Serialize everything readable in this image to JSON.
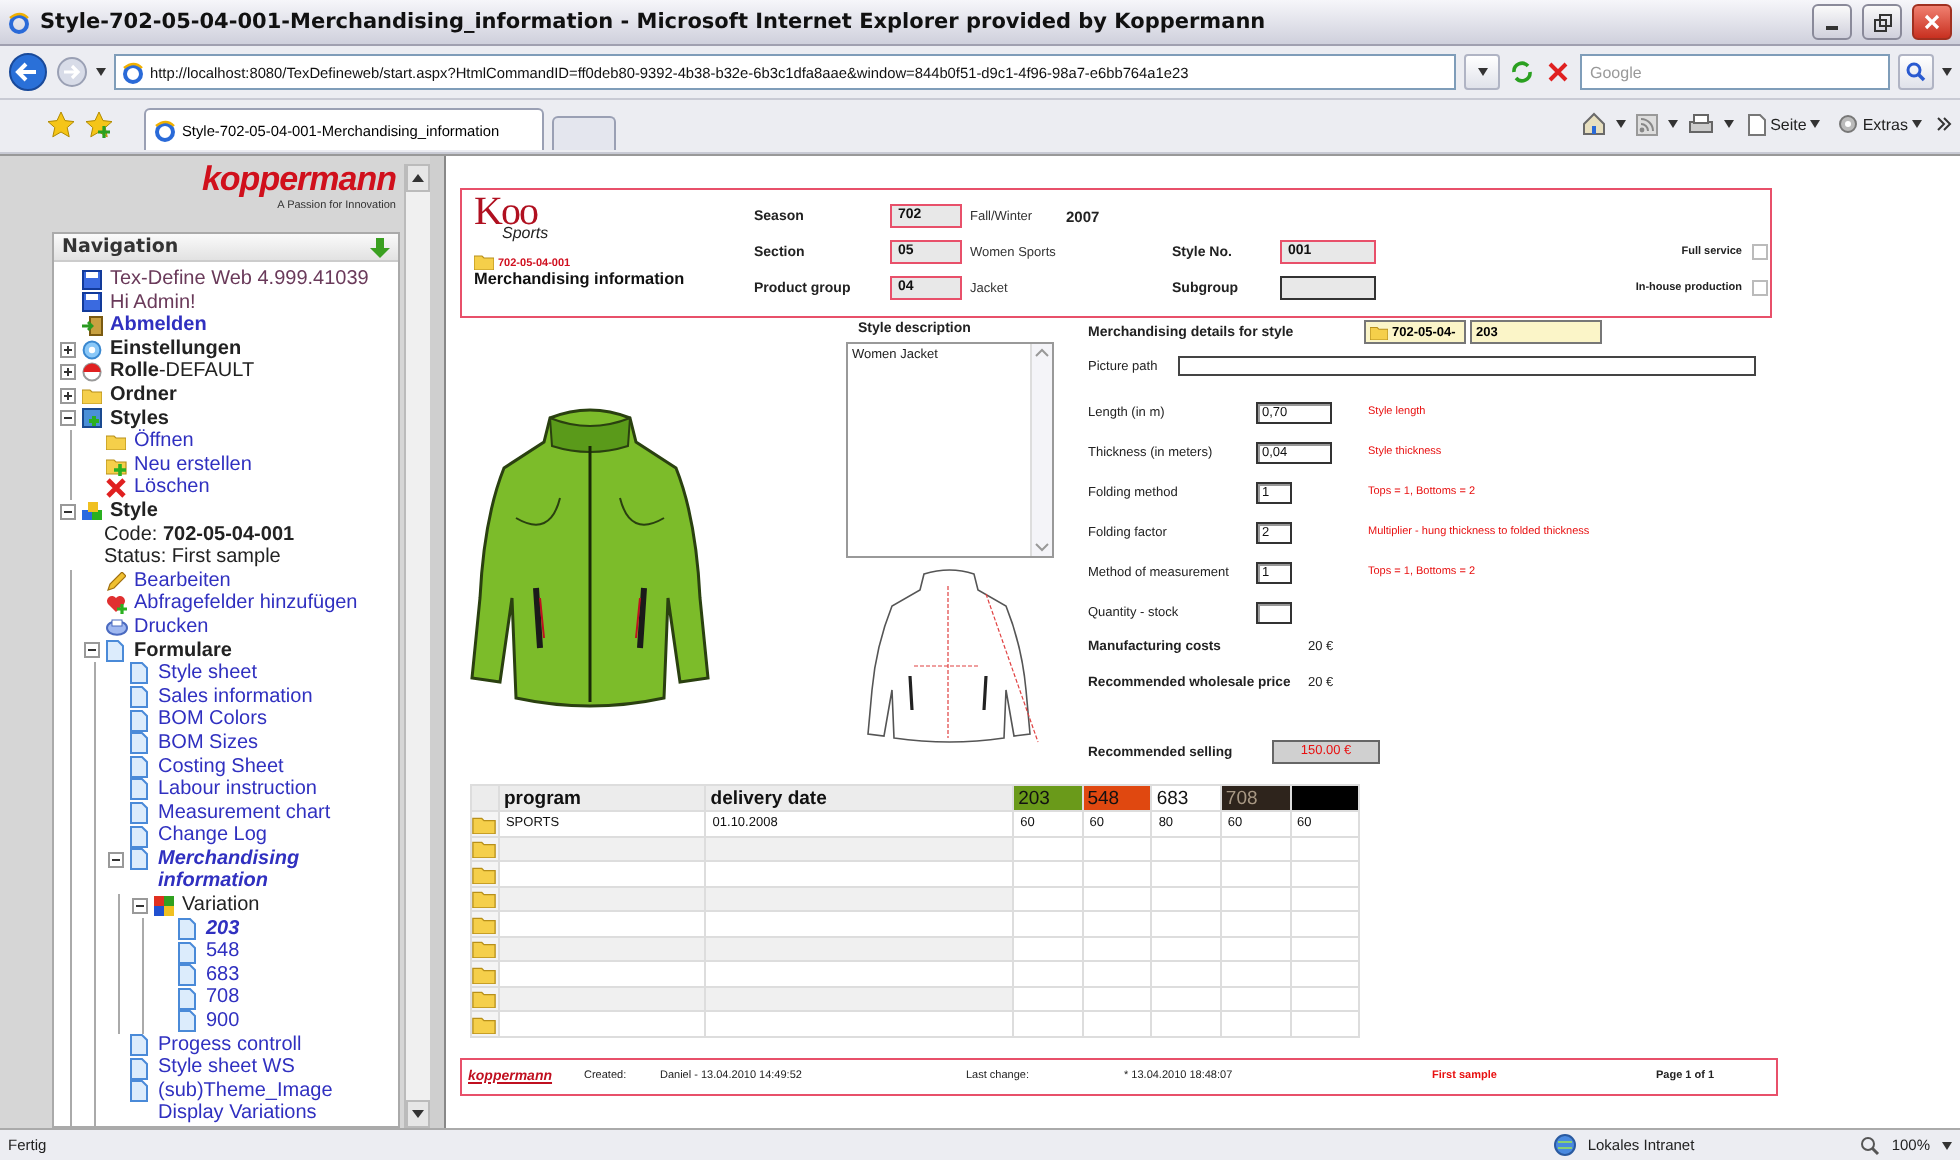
{
  "window": {
    "title": "Style-702-05-04-001-Merchandising_information - Microsoft Internet Explorer provided by Koppermann"
  },
  "address_bar": {
    "url": "http://localhost:8080/TexDefineweb/start.aspx?HtmlCommandID=ff0deb80-9392-4b38-b32e-6b3c1dfa8aae&window=844b0f51-d9c1-4f96-98a7-e6bb764a1e23"
  },
  "search": {
    "placeholder": "Google"
  },
  "tabs": [
    {
      "label": "Style-702-05-04-001-Merchandising_information",
      "selected": true
    }
  ],
  "command_bar": {
    "page_menu": "Seite",
    "tools_menu": "Extras"
  },
  "sidebar": {
    "logo": "koppermann",
    "tagline": "A Passion for Innovation",
    "title": "Navigation",
    "tree": [
      {
        "label": "Tex-Define Web 4.999.41039",
        "kind": "info",
        "link": false,
        "bold": false
      },
      {
        "label": "Hi Admin!",
        "kind": "info",
        "link": false,
        "bold": false
      },
      {
        "label": "Abmelden",
        "kind": "logout",
        "link": true,
        "bold": true
      },
      {
        "label": "Einstellungen",
        "kind": "settings",
        "link": false,
        "bold": true,
        "expanded": false
      },
      {
        "label": "**Rolle**-DEFAULT",
        "kind": "role",
        "link": false,
        "bold": false,
        "expanded": false
      },
      {
        "label": "Ordner",
        "kind": "folder",
        "link": false,
        "bold": true,
        "expanded": false
      },
      {
        "label": "Styles",
        "kind": "styles",
        "link": false,
        "bold": true,
        "expanded": true,
        "children": [
          {
            "label": "Öffnen",
            "kind": "open",
            "link": true,
            "bold": false
          },
          {
            "label": "Neu erstellen",
            "kind": "new",
            "link": true,
            "bold": false
          },
          {
            "label": "Löschen",
            "kind": "delete",
            "link": true,
            "bold": false
          }
        ]
      },
      {
        "label": "Style",
        "kind": "style",
        "link": false,
        "bold": true,
        "expanded": true,
        "details": [
          "Code: **702-05-04-001**",
          "Status: First sample"
        ],
        "children": [
          {
            "label": "Bearbeiten",
            "kind": "edit",
            "link": true,
            "bold": false
          },
          {
            "label": "Abfragefelder hinzufügen",
            "kind": "fields",
            "link": true,
            "bold": false
          },
          {
            "label": "Drucken",
            "kind": "print",
            "link": true,
            "bold": false
          },
          {
            "label": "Formulare",
            "kind": "doc",
            "link": false,
            "bold": true,
            "expanded": true,
            "children": [
              {
                "label": "Style sheet",
                "kind": "doc",
                "link": true,
                "bold": false,
                "selected": false
              },
              {
                "label": "Sales information",
                "kind": "doc",
                "link": true,
                "bold": false,
                "selected": false
              },
              {
                "label": "BOM Colors",
                "kind": "doc",
                "link": true,
                "bold": false,
                "selected": false
              },
              {
                "label": "BOM Sizes",
                "kind": "doc",
                "link": true,
                "bold": false,
                "selected": false
              },
              {
                "label": "Costing Sheet",
                "kind": "doc",
                "link": true,
                "bold": false,
                "selected": false
              },
              {
                "label": "Labour instruction",
                "kind": "doc",
                "link": true,
                "bold": false,
                "selected": false
              },
              {
                "label": "Measurement chart",
                "kind": "doc",
                "link": true,
                "bold": false,
                "selected": false
              },
              {
                "label": "Change Log",
                "kind": "doc",
                "link": true,
                "bold": false,
                "selected": false
              },
              {
                "label": "Merchandising information",
                "kind": "doc",
                "link": true,
                "bold": false,
                "selected": true,
                "expanded": true,
                "children": [
                  {
                    "label": "Variation",
                    "kind": "variation",
                    "link": false,
                    "bold": false,
                    "expanded": true,
                    "children": [
                      {
                        "label": "203",
                        "kind": "doc",
                        "link": true,
                        "bold": false,
                        "selected": true
                      },
                      {
                        "label": "548",
                        "kind": "doc",
                        "link": true,
                        "bold": false,
                        "selected": false
                      },
                      {
                        "label": "683",
                        "kind": "doc",
                        "link": true,
                        "bold": false,
                        "selected": false
                      },
                      {
                        "label": "708",
                        "kind": "doc",
                        "link": true,
                        "bold": false,
                        "selected": false
                      },
                      {
                        "label": "900",
                        "kind": "doc",
                        "link": true,
                        "bold": false,
                        "selected": false
                      }
                    ]
                  }
                ]
              },
              {
                "label": "Progess controll",
                "kind": "doc",
                "link": true,
                "bold": false,
                "selected": false
              },
              {
                "label": "Style sheet WS",
                "kind": "doc",
                "link": true,
                "bold": false,
                "selected": false
              },
              {
                "label": "(sub)Theme_Image Display Variations",
                "kind": "doc",
                "link": true,
                "bold": false,
                "selected": false
              }
            ]
          }
        ]
      }
    ]
  },
  "form": {
    "logo": {
      "text": "Koo",
      "sub": "Sports"
    },
    "code": "702-05-04-001",
    "title": "Merchandising information",
    "fields": [
      {
        "label": "Season",
        "value": "702",
        "required": true,
        "note": "Fall/Winter",
        "extra": "2007"
      },
      {
        "label": "Section",
        "value": "05",
        "required": true,
        "note": "Women Sports"
      },
      {
        "label": "Product group",
        "value": "04",
        "required": true,
        "note": "Jacket"
      }
    ],
    "fields_right": [
      {
        "label": "Style No.",
        "value": "001",
        "required": true
      },
      {
        "label": "Subgroup",
        "required": false
      }
    ],
    "options": [
      {
        "label": "Full service",
        "checked": false
      },
      {
        "label": "In-house production",
        "checked": false
      }
    ]
  },
  "style_description": {
    "label": "Style description",
    "value": "Women Jacket"
  },
  "details": {
    "label": "Merchandising details for style",
    "code": "702-05-04-",
    "variation": "203",
    "picture_path_label": "Picture path",
    "parameters": [
      {
        "label": "Length (in m)",
        "value": "0,70",
        "note": "Style length",
        "kind": "wide"
      },
      {
        "label": "Thickness (in meters)",
        "value": "0,04",
        "note": "Style thickness",
        "kind": "wide"
      },
      {
        "label": "Folding method",
        "value": "1",
        "note": "Tops = 1, Bottoms = 2",
        "kind": "narrow"
      },
      {
        "label": "Folding factor",
        "value": "2",
        "note": "Multiplier - hung thickness to folded thickness",
        "kind": "narrow"
      },
      {
        "label": "Method of measurement",
        "value": "1",
        "note": "Tops = 1, Bottoms = 2",
        "kind": "narrow"
      },
      {
        "label": "Quantity - stock",
        "kind": "narrow"
      }
    ],
    "costs": [
      {
        "label": "Manufacturing costs",
        "value": "20 €"
      },
      {
        "label": "Recommended wholesale price",
        "value": "20 €"
      }
    ],
    "selling": {
      "label": "Recommended selling",
      "value": "150.00 €"
    }
  },
  "table": {
    "columns": [
      {
        "label": "program"
      },
      {
        "label": "delivery date"
      }
    ],
    "variations": [
      {
        "label": "203",
        "color": "#6a9a1a"
      },
      {
        "label": "548",
        "color": "#e04810"
      },
      {
        "label": "683",
        "color": "#ffffff"
      },
      {
        "label": "708",
        "color": "#2e241c"
      },
      {
        "color": "#000000"
      }
    ],
    "rows": [
      {
        "kind": "filled",
        "program": "SPORTS",
        "delivery": "01.10.2008",
        "quantities": [
          "60",
          "60",
          "80",
          "60",
          "60"
        ]
      },
      {
        "kind": "empty"
      },
      {
        "kind": "empty"
      },
      {
        "kind": "empty"
      },
      {
        "kind": "empty"
      },
      {
        "kind": "empty"
      },
      {
        "kind": "empty"
      },
      {
        "kind": "empty"
      },
      {
        "kind": "empty"
      }
    ]
  },
  "footer": {
    "logo": "koppermann",
    "created_label": "Created:",
    "created": "Daniel - 13.04.2010 14:49:52",
    "changed_label": "Last change:",
    "changed": "* 13.04.2010 18:48:07",
    "status": "First sample",
    "page": "Page 1 of 1"
  },
  "status_bar": {
    "text": "Fertig",
    "zone": "Lokales Intranet",
    "zoom": "100%"
  }
}
